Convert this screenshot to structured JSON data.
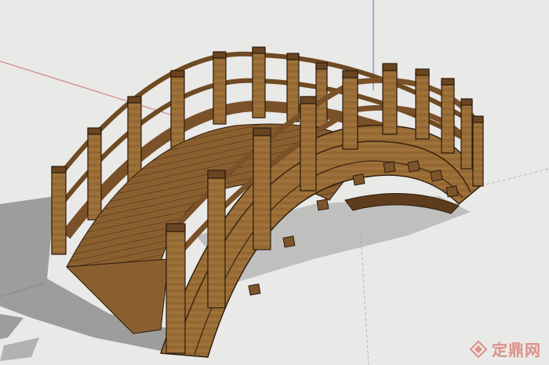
{
  "viewport": {
    "background": "#e9e9e7",
    "shadow_color": "#8f8f8f",
    "axis_red": "#c85a5a",
    "axis_blue": "#3a4bd0",
    "axis_green": "#2e9a43"
  },
  "model": {
    "type": "arched wooden bridge",
    "wood_light": "#a4783f",
    "wood_mid": "#8a5f2f",
    "wood_dark": "#5e3d1c",
    "outline": "#2a1a0c"
  },
  "watermark": {
    "text": "定鼎网",
    "color": "#d24a3a",
    "icon": "diamond-logo-icon"
  }
}
